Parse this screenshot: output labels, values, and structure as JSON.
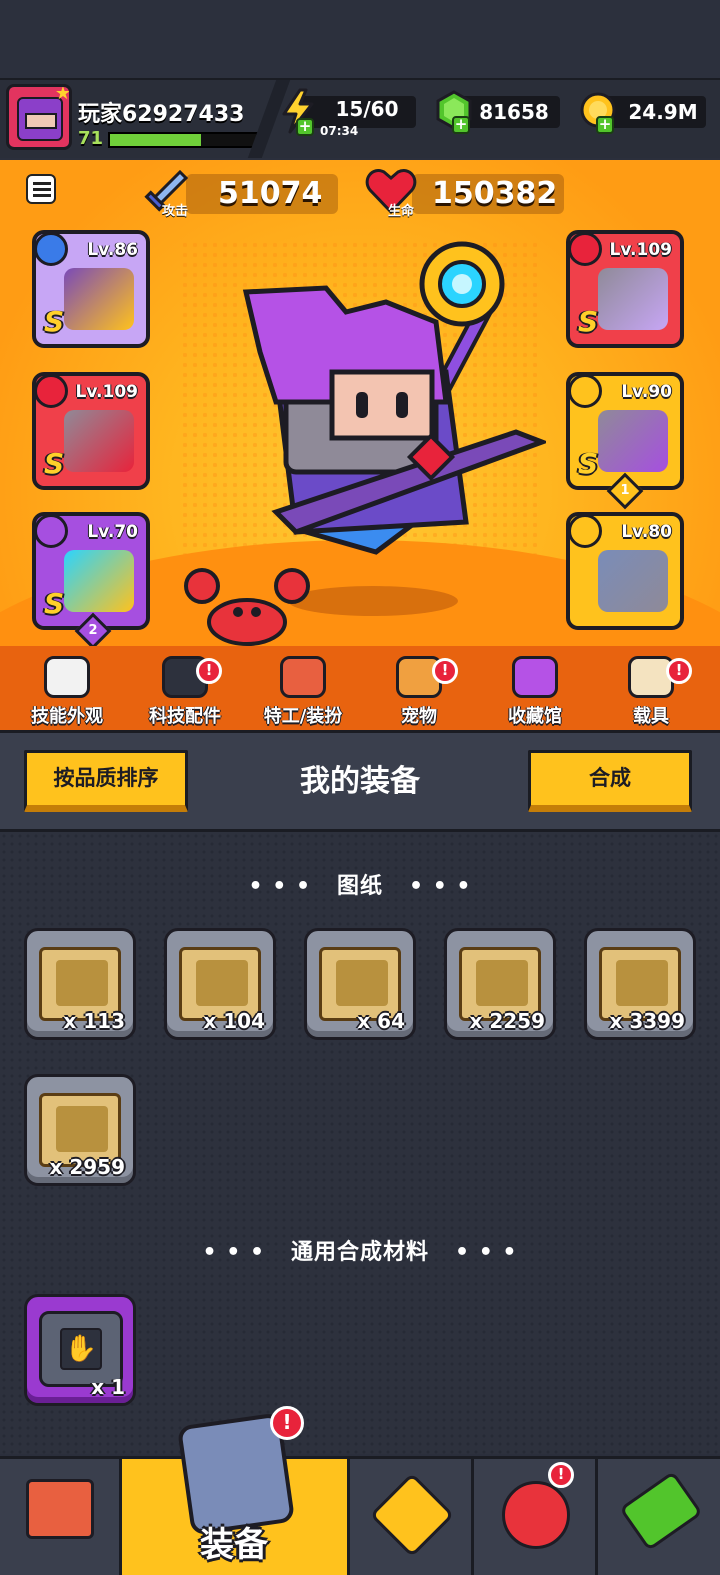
{
  "player": {
    "name": "玩家62927433",
    "level": "71",
    "xp_fraction": 0.62
  },
  "resources": {
    "energy": "15/60",
    "energy_timer": "07:34",
    "gems": "81658",
    "gold": "24.9M"
  },
  "stats": {
    "attack_label": "攻击",
    "attack_value": "51074",
    "hp_label": "生命",
    "hp_value": "150382"
  },
  "equipment_slots": [
    {
      "id": "weapon",
      "level": "Lv.86",
      "grade": "S",
      "color": "#c7a6f5"
    },
    {
      "id": "necklace",
      "level": "Lv.109",
      "grade": "S",
      "color": "#f0404a"
    },
    {
      "id": "gloves",
      "level": "Lv.70",
      "grade": "S",
      "color": "#a64fe0",
      "stars": "2"
    },
    {
      "id": "armor",
      "level": "Lv.109",
      "grade": "S",
      "color": "#f0404a"
    },
    {
      "id": "belt",
      "level": "Lv.90",
      "grade": "S",
      "color": "#ffc21d",
      "stars": "1"
    },
    {
      "id": "boots",
      "level": "Lv.80",
      "grade": "",
      "color": "#ffc21d"
    }
  ],
  "feature_nav": [
    {
      "label": "技能外观",
      "alert": false
    },
    {
      "label": "科技配件",
      "alert": true
    },
    {
      "label": "特工/装扮",
      "alert": false
    },
    {
      "label": "宠物",
      "alert": true
    },
    {
      "label": "收藏馆",
      "alert": false
    },
    {
      "label": "载具",
      "alert": true
    }
  ],
  "equip_bar": {
    "sort_button": "按品质排序",
    "title": "我的装备",
    "merge_button": "合成"
  },
  "blueprints": {
    "title": "图纸",
    "items": [
      {
        "icon": "weapon-blueprint-icon",
        "qty": "x 113"
      },
      {
        "icon": "armor-blueprint-icon",
        "qty": "x 104"
      },
      {
        "icon": "necklace-blueprint-icon",
        "qty": "x 64"
      },
      {
        "icon": "belt-blueprint-icon",
        "qty": "x 2259"
      },
      {
        "icon": "glove-blueprint-icon",
        "qty": "x 3399"
      },
      {
        "icon": "boot-blueprint-icon",
        "qty": "x 2959"
      }
    ]
  },
  "materials": {
    "title": "通用合成材料",
    "items": [
      {
        "icon": "glove-material-icon",
        "qty": "x 1"
      }
    ]
  },
  "alert_mark": "!",
  "bottom_nav": {
    "active_label": "装备"
  }
}
